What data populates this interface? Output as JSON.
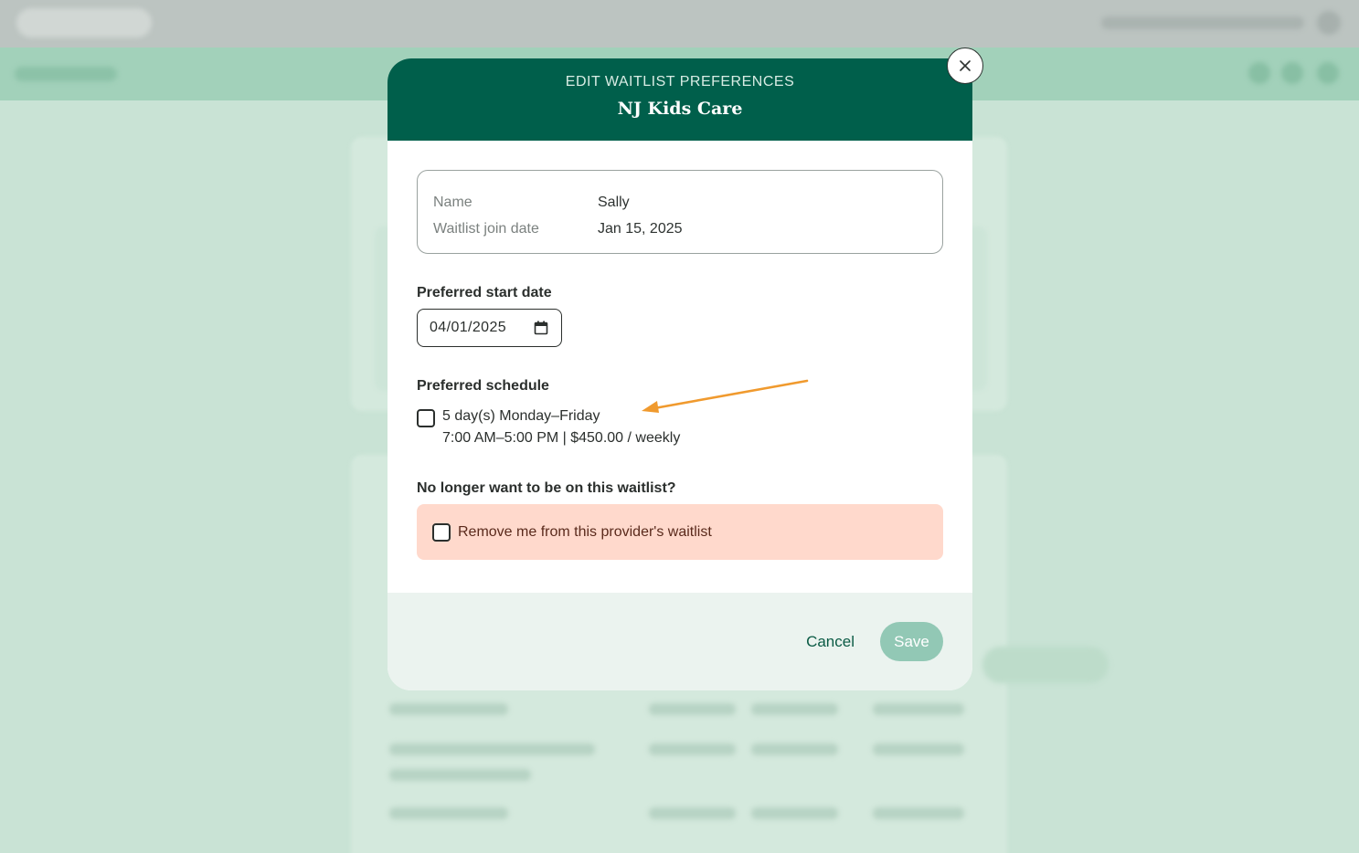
{
  "modal": {
    "eyebrow": "EDIT WAITLIST PREFERENCES",
    "title": "NJ Kids Care",
    "close_icon": "close-icon",
    "info": {
      "name_label": "Name",
      "name_value": "Sally",
      "join_label": "Waitlist join date",
      "join_value": "Jan 15, 2025"
    },
    "start_date": {
      "label": "Preferred start date",
      "value": "04/01/2025",
      "icon": "calendar-icon"
    },
    "schedule": {
      "label": "Preferred schedule",
      "option": {
        "line1": "5 day(s) Monday–Friday",
        "line2": "7:00 AM–5:00 PM | $450.00 / weekly",
        "checked": false
      }
    },
    "remove": {
      "question": "No longer want to be on this waitlist?",
      "checkbox_label": "Remove me from this provider's waitlist",
      "checked": false
    },
    "footer": {
      "cancel_label": "Cancel",
      "save_label": "Save"
    }
  },
  "colors": {
    "header_bg": "#005f4b",
    "save_disabled": "#92c8b5",
    "remove_bg": "#ffd9cc",
    "annotation_arrow": "#f09a2e"
  }
}
